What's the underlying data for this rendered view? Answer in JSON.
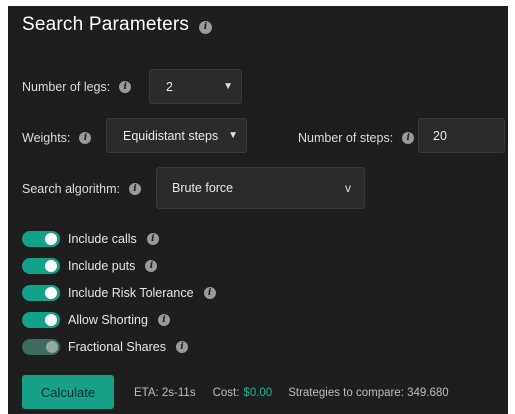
{
  "title": "Search Parameters",
  "legs": {
    "label": "Number of legs:",
    "value": "2"
  },
  "weights": {
    "label": "Weights:",
    "value": "Equidistant steps"
  },
  "steps": {
    "label": "Number of steps:",
    "value": "20"
  },
  "algorithm": {
    "label": "Search algorithm:",
    "value": "Brute force",
    "caret": "v"
  },
  "toggles": [
    {
      "label": "Include calls",
      "on": true
    },
    {
      "label": "Include puts",
      "on": true
    },
    {
      "label": "Include Risk Tolerance",
      "on": true
    },
    {
      "label": "Allow Shorting",
      "on": true
    },
    {
      "label": "Fractional Shares",
      "on": false
    }
  ],
  "calculate_label": "Calculate",
  "footer": {
    "eta": "ETA: 2s-11s",
    "cost_label": "Cost:",
    "cost_value": "$0.00",
    "strategies": "Strategies to compare: 349.680"
  },
  "colors": {
    "accent": "#16a085",
    "panel": "#1e1e1e",
    "cost": "#18b894"
  },
  "icons": {
    "info": "info-icon",
    "caret": "chevron-down-icon"
  }
}
